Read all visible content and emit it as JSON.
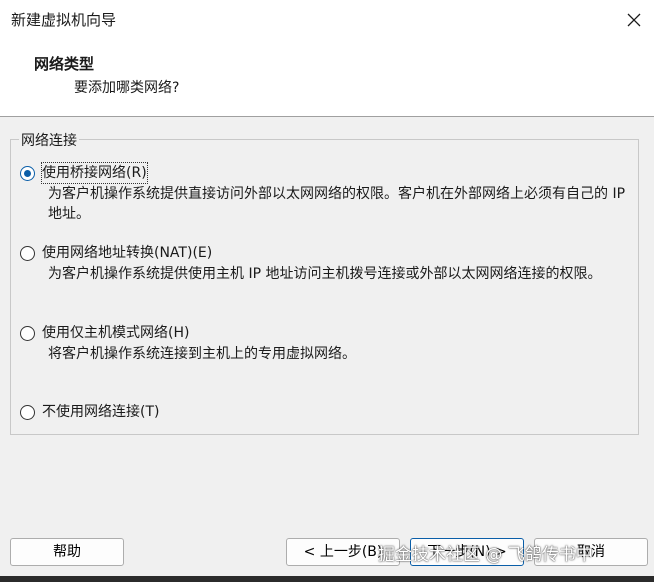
{
  "window": {
    "title": "新建虚拟机向导"
  },
  "header": {
    "title": "网络类型",
    "subtitle": "要添加哪类网络?"
  },
  "group": {
    "title": "网络连接"
  },
  "options": [
    {
      "label": "使用桥接网络(R)",
      "desc": "为客户机操作系统提供直接访问外部以太网网络的权限。客户机在外部网络上必须有自己的 IP 地址。",
      "checked": true
    },
    {
      "label": "使用网络地址转换(NAT)(E)",
      "desc": "为客户机操作系统提供使用主机 IP 地址访问主机拨号连接或外部以太网网络连接的权限。",
      "checked": false
    },
    {
      "label": "使用仅主机模式网络(H)",
      "desc": "将客户机操作系统连接到主机上的专用虚拟网络。",
      "checked": false
    },
    {
      "label": "不使用网络连接(T)",
      "desc": "",
      "checked": false
    }
  ],
  "buttons": {
    "help": "帮助",
    "back": "< 上一步(B)",
    "next": "下一步(N) >",
    "cancel": "取消"
  },
  "watermark": "掘金技术社区 @ 飞鸽传书中",
  "colors": {
    "accent": "#0a5ea8",
    "background": "#f0f0f0",
    "header_bg": "#ffffff"
  }
}
